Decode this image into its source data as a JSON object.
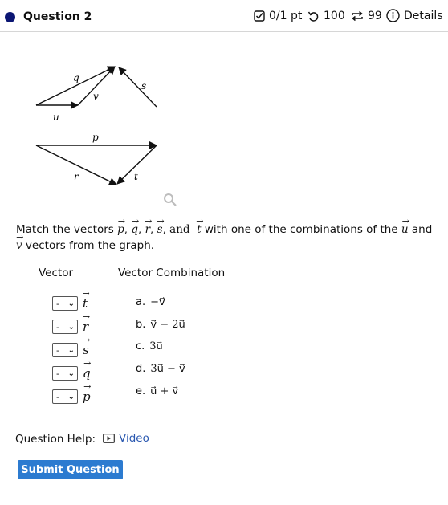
{
  "header": {
    "title": "Question 2",
    "score": "0/1 pt",
    "attempts": "100",
    "retries": "99",
    "details": "Details"
  },
  "graph": {
    "labels": {
      "q": "q",
      "v": "v",
      "u": "u",
      "s": "s",
      "p": "p",
      "r": "r",
      "t": "t"
    }
  },
  "prompt": {
    "lead": "Match the vectors ",
    "vectors": [
      "p",
      "q",
      "r",
      "s"
    ],
    "and_word": "and",
    "last_vector": "t",
    "mid": " with one of the combinations of the ",
    "u": "u",
    "and2": " and ",
    "v": "v",
    "tail": " vectors from the graph."
  },
  "table": {
    "col_vector": "Vector",
    "col_combination": "Vector Combination",
    "rows": [
      {
        "selected": "-",
        "vector": "t"
      },
      {
        "selected": "-",
        "vector": "r"
      },
      {
        "selected": "-",
        "vector": "s"
      },
      {
        "selected": "-",
        "vector": "q"
      },
      {
        "selected": "-",
        "vector": "p"
      }
    ],
    "options": [
      {
        "letter": "a.",
        "expr": "−v⃗"
      },
      {
        "letter": "b.",
        "expr": "v⃗ − 2u⃗"
      },
      {
        "letter": "c.",
        "expr": "3u⃗"
      },
      {
        "letter": "d.",
        "expr": "3u⃗ − v⃗"
      },
      {
        "letter": "e.",
        "expr": "u⃗ + v⃗"
      }
    ]
  },
  "help": {
    "label": "Question Help:",
    "video": "Video"
  },
  "submit_label": "Submit Question"
}
